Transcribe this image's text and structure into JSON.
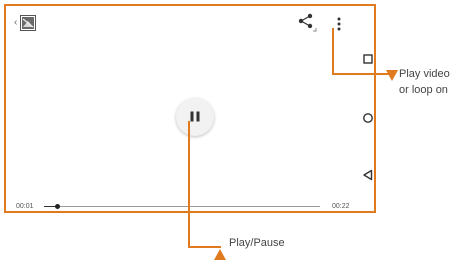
{
  "player": {
    "back_glyph": "‹",
    "thumbnail_icon": "video-thumbnail-icon",
    "share_icon": "share-icon",
    "more_icon": "more-vertical-icon",
    "play_pause_icon": "pause-icon",
    "current_time": "00:01",
    "total_time": "00:22",
    "progress_fraction": 0.05
  },
  "nav_bar": {
    "recents_icon": "square-icon",
    "home_icon": "circle-icon",
    "back_icon": "triangle-back-icon"
  },
  "annotations": {
    "more_menu_label_line1": "Play video",
    "more_menu_label_line2": "or loop on",
    "play_pause_label": "Play/Pause"
  },
  "colors": {
    "accent": "#e07a1f",
    "text_dark": "#444444",
    "track": "#9a9a9a"
  }
}
